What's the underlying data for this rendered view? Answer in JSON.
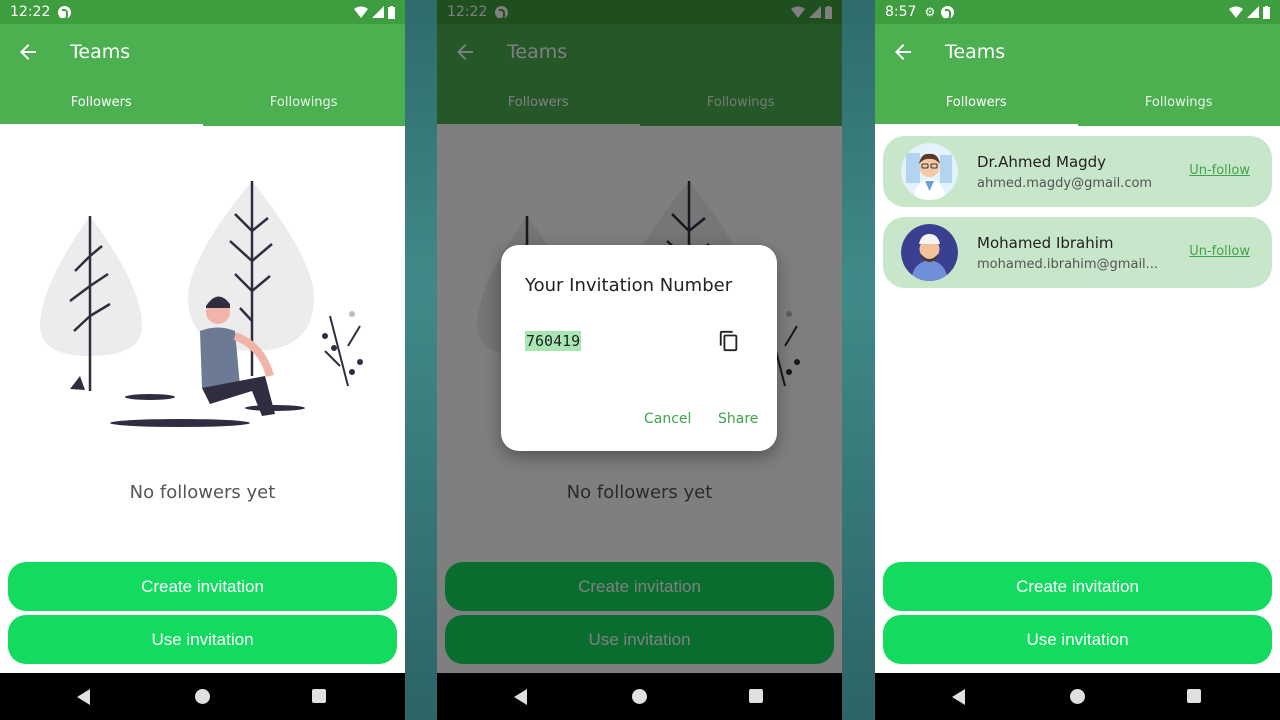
{
  "screens": [
    {
      "status_time": "12:22",
      "title": "Teams",
      "tabs": [
        "Followers",
        "Followings"
      ],
      "active_tab": 0,
      "empty_text": "No followers yet",
      "buttons": {
        "create": "Create invitation",
        "use": "Use invitation"
      }
    },
    {
      "status_time": "12:22",
      "title": "Teams",
      "tabs": [
        "Followers",
        "Followings"
      ],
      "active_tab": 0,
      "empty_text": "No followers yet",
      "buttons": {
        "create": "Create invitation",
        "use": "Use invitation"
      },
      "dialog": {
        "title": "Your Invitation Number",
        "code": "760419",
        "cancel": "Cancel",
        "share": "Share"
      }
    },
    {
      "status_time": "8:57",
      "title": "Teams",
      "tabs": [
        "Followers",
        "Followings"
      ],
      "active_tab": 0,
      "followers": [
        {
          "name": "Dr.Ahmed Magdy",
          "email": "ahmed.magdy@gmail.com",
          "action": "Un-follow"
        },
        {
          "name": "Mohamed Ibrahim",
          "email": "mohamed.ibrahim@gmail...",
          "action": "Un-follow"
        }
      ],
      "buttons": {
        "create": "Create invitation",
        "use": "Use invitation"
      }
    }
  ],
  "colors": {
    "appbar": "#4caf50",
    "statusbar": "#3e9d3e",
    "primary_button": "#12db60",
    "card": "#c8e6c9",
    "accent_text": "#3ea54a"
  },
  "icons": [
    "back-arrow-icon",
    "wifi-icon",
    "signal-icon",
    "battery-icon",
    "copy-icon",
    "nav-back-icon",
    "nav-home-icon",
    "nav-recents-icon"
  ]
}
